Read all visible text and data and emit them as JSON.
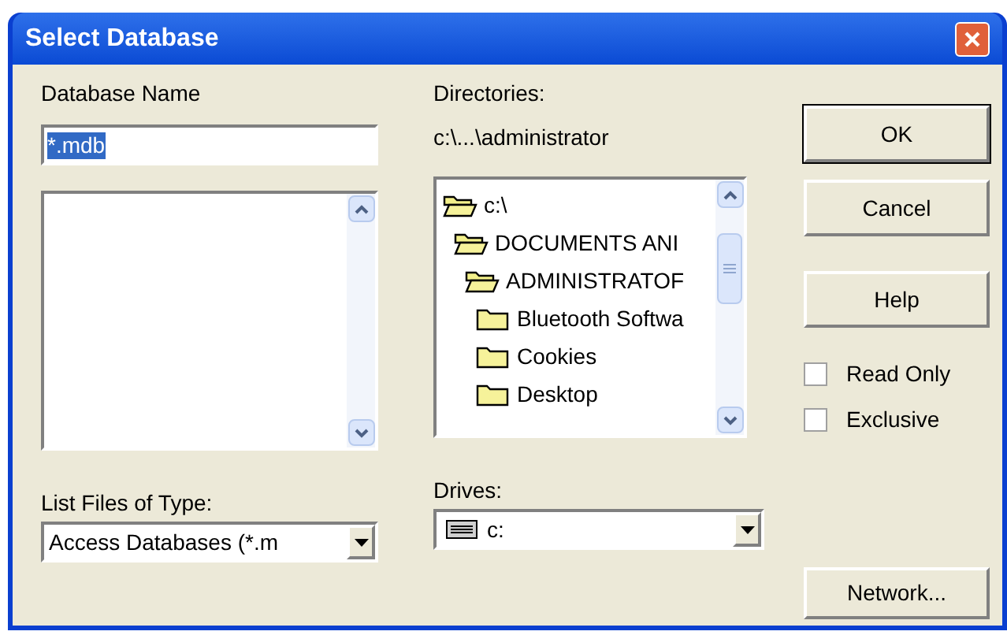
{
  "window": {
    "title": "Select Database"
  },
  "database_name": {
    "label": "Database Name",
    "value": "*.mdb"
  },
  "directories": {
    "label": "Directories:",
    "path": "c:\\...\\administrator",
    "tree": [
      {
        "label": "c:\\",
        "open": true,
        "children": [
          {
            "label": "DOCUMENTS ANI",
            "open": true,
            "children": [
              {
                "label": "ADMINISTRATOF",
                "open": true,
                "children": [
                  {
                    "label": "Bluetooth Softwa",
                    "open": false
                  },
                  {
                    "label": "Cookies",
                    "open": false
                  },
                  {
                    "label": "Desktop",
                    "open": false
                  }
                ]
              }
            ]
          }
        ]
      }
    ]
  },
  "file_type": {
    "label": "List Files of Type:",
    "value": "Access Databases (*.m"
  },
  "drives": {
    "label": "Drives:",
    "value": "c:"
  },
  "buttons": [
    {
      "label": "OK",
      "default": true
    },
    {
      "label": "Cancel",
      "default": false
    },
    {
      "label": "Help",
      "default": false
    }
  ],
  "options": [
    {
      "label": "Read Only",
      "checked": false
    },
    {
      "label": "Exclusive",
      "checked": false
    }
  ],
  "network_button": {
    "label": "Network..."
  }
}
